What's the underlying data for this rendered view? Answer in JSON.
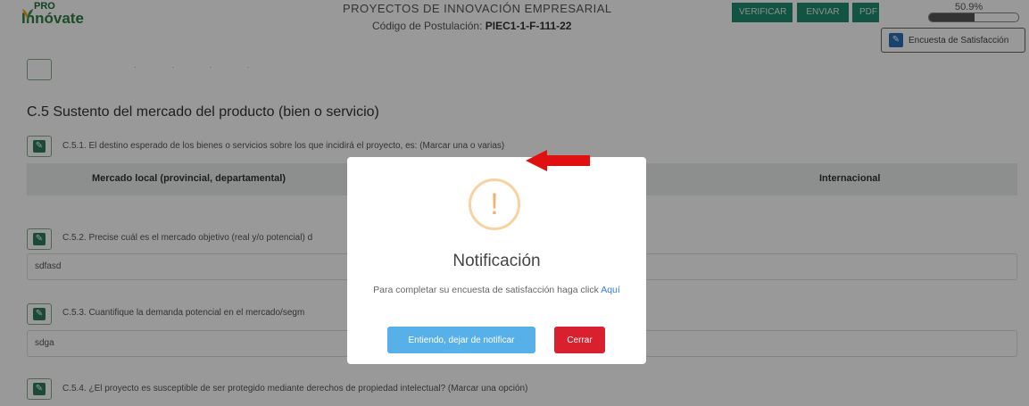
{
  "header": {
    "logo_pro": "PRO",
    "logo_name": "Innóvate",
    "title": "PROYECTOS DE INNOVACIÓN EMPRESARIAL",
    "code_label": "Código de Postulación:",
    "code_value": "PIEC1-1-F-111-22",
    "verify_label": "VERIFICAR",
    "send_label": "ENVIAR",
    "pdf_label": "PDF",
    "progress_text": "50.9%",
    "progress_value": 50.9,
    "survey_label": "Encuesta de Satisfacción"
  },
  "section": {
    "title": "C.5 Sustento del mercado del producto (bien o servicio)",
    "q1": "C.5.1. El destino esperado de los bienes o servicios sobre los que incidirá el proyecto, es: (Marcar una o varias)",
    "table_headers": [
      "Mercado local (provincial, departamental)",
      "Internacional"
    ],
    "q2": "C.5.2. Precise cuál es el mercado objetivo (real y/o potencial) d",
    "a2": "sdfasd",
    "q3": "C.5.3. Cuantifique la demanda potencial en el mercado/segm",
    "a3": "sdga",
    "q4": "C.5.4. ¿El proyecto es susceptible de ser protegido mediante derechos de propiedad intelectual? (Marcar una opción)"
  },
  "modal": {
    "icon": "!",
    "title": "Notificación",
    "text": "Para completar su encuesta de satisfacción haga click",
    "link": "Aquí",
    "primary_label": "Entiendo, dejar de notificar",
    "close_label": "Cerrar"
  },
  "colors": {
    "header_button": "#1f8a70",
    "primary": "#58b0e8",
    "danger": "#d9202f",
    "warning": "#f8d2a3",
    "arrow": "#e01010"
  }
}
